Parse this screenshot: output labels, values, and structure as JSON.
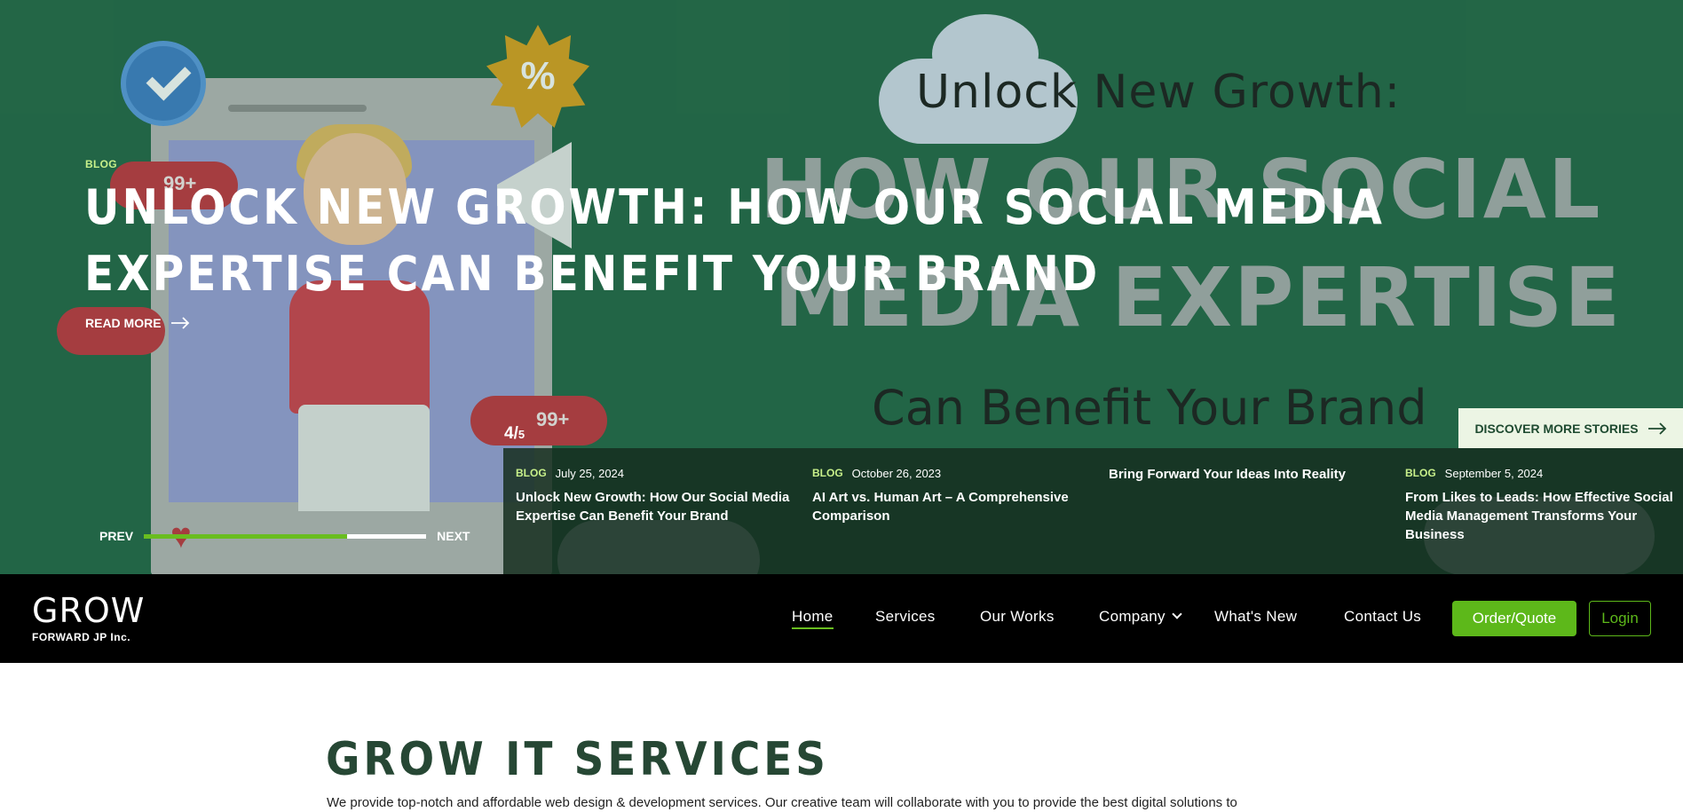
{
  "hero": {
    "tag": "BLOG",
    "title": "UNLOCK NEW GROWTH: HOW OUR SOCIAL MEDIA EXPERTISE CAN BENEFIT YOUR BRAND",
    "read_more": "READ MORE",
    "prev": "PREV",
    "next": "NEXT",
    "progress": 0.72,
    "discover": "DISCOVER MORE STORIES",
    "counter": {
      "current": "4",
      "separator": "/",
      "total": "5"
    },
    "art": {
      "line1": "Unlock New Growth:",
      "line2": "HOW OUR SOCIAL",
      "line3": "MEDIA EXPERTISE",
      "line4": "Can Benefit Your Brand",
      "percent": "%",
      "bubble_count": "99+"
    }
  },
  "stories": [
    {
      "tag": "BLOG",
      "date": "July 25, 2024",
      "title": "Unlock New Growth: How Our Social Media Expertise Can Benefit Your Brand"
    },
    {
      "tag": "BLOG",
      "date": "October 26, 2023",
      "title": "AI Art vs. Human Art – A Comprehensive Comparison"
    },
    {
      "tag": "",
      "date": "",
      "title": "Bring Forward Your Ideas Into Reality"
    },
    {
      "tag": "BLOG",
      "date": "September 5, 2024",
      "title": "From Likes to Leads: How Effective Social Media Management Transforms Your Business"
    }
  ],
  "header": {
    "logo_word": "GROW",
    "logo_sub": "FORWARD JP Inc.",
    "nav": [
      "Home",
      "Services",
      "Our Works",
      "Company",
      "What's New",
      "Contact Us"
    ],
    "order_button": "Order/Quote",
    "login_button": "Login"
  },
  "services": {
    "title": "GROW IT SERVICES",
    "description": "We provide top-notch and affordable web design & development services. Our creative team will collaborate with you to provide the best digital solutions to"
  },
  "colors": {
    "hero_bg": "#236646",
    "accent_green": "#5db81a",
    "tag_green": "#c8f08a",
    "heading_dark_green": "#264734"
  },
  "icons": {
    "read_more": "arrow-right-icon",
    "discover": "arrow-right-icon",
    "company_menu": "chevron-down-icon"
  }
}
